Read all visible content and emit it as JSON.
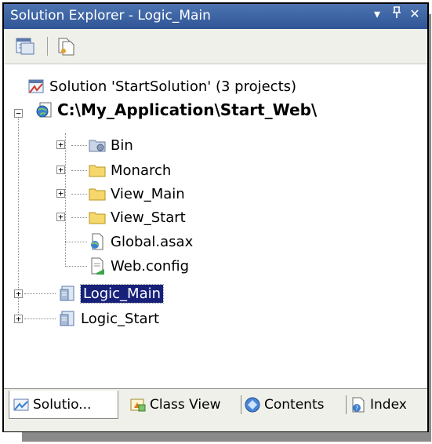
{
  "window": {
    "title": "Solution Explorer - Logic_Main",
    "dropdown_glyph": "▾",
    "pin_glyph": "ᵖ",
    "close_glyph": "✕"
  },
  "tree": {
    "solution_label": "Solution 'StartSolution' (3 projects)",
    "web_project_label": "C:\\My_Application\\Start_Web\\",
    "web_children": [
      "Bin",
      "Monarch",
      "View_Main",
      "View_Start",
      "Global.asax",
      "Web.config"
    ],
    "projects": [
      "Logic_Main",
      "Logic_Start"
    ],
    "selected": "Logic_Main"
  },
  "tabs": [
    "Solutio...",
    "Class View",
    "Contents",
    "Index"
  ],
  "colors": {
    "selection": "#17217a",
    "title_bar": "#3a5fa0",
    "folder": "#f5d76b"
  },
  "icons": [
    "properties-icon",
    "show-all-files-icon",
    "solution-icon",
    "web-project-icon",
    "bin-folder-icon",
    "folder-icon",
    "global-asax-icon",
    "config-file-icon",
    "class-library-icon",
    "class-view-icon",
    "contents-icon",
    "index-icon"
  ]
}
